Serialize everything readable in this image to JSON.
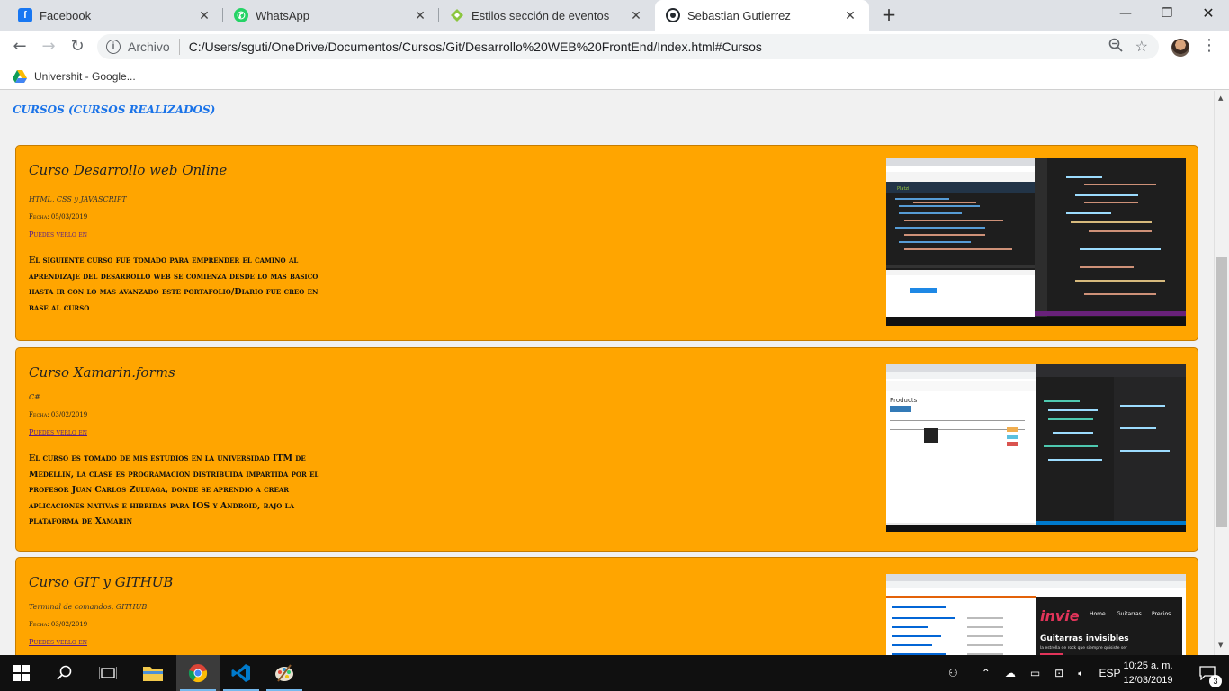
{
  "browser": {
    "tabs": [
      {
        "title": "Facebook",
        "icon": "facebook-icon",
        "color": "#1877f2"
      },
      {
        "title": "WhatsApp",
        "icon": "whatsapp-icon",
        "color": "#25d366"
      },
      {
        "title": "Estilos sección de eventos",
        "icon": "codepen-icon",
        "color": "#8cc63f"
      },
      {
        "title": "Sebastian Gutierrez",
        "icon": "github-icon",
        "color": "#24292e",
        "active": true
      }
    ],
    "omnibox": {
      "label": "Archivo",
      "url": "C:/Users/sguti/OneDrive/Documentos/Cursos/Git/Desarrollo%20WEB%20FrontEnd/Index.html#Cursos"
    },
    "bookmarks": [
      {
        "label": "Univershit - Google..."
      }
    ]
  },
  "page": {
    "section_title": "CURSOS (CURSOS REALIZADOS)",
    "courses": [
      {
        "title": "Curso Desarrollo web Online",
        "subtitle": "HTML, CSS y JAVASCRIPT",
        "date": "Fecha: 05/03/2019",
        "link": "Puedes verlo en",
        "description": "El siguiente curso fue tomado para emprender el camino al aprendizaje del desarrollo web se comienza desde lo mas basico hasta ir con lo mas avanzado este portafolio/Diario fue creo en base al curso"
      },
      {
        "title": "Curso Xamarin.forms",
        "subtitle": "C#",
        "date": "Fecha: 03/02/2019",
        "link": "Puedes verlo en",
        "description": "El curso es tomado de mis estudios en la universidad ITM de Medellin, la clase es programacion distribuida impartida por el profesor Juan Carlos Zuluaga, donde se aprendio a crear aplicaciones nativas e hibridas para IOS y Android, bajo la plataforma de Xamarin"
      },
      {
        "title": "Curso GIT y GITHUB",
        "subtitle": "Terminal de comandos, GITHUB",
        "date": "Fecha: 03/02/2019",
        "link": "Puedes verlo en",
        "description": ""
      }
    ],
    "shot_texts": {
      "platzi": "Platzi",
      "products": "Products",
      "invie_logo": "invie",
      "invie_nav": [
        "Home",
        "Guitarras",
        "Precios"
      ],
      "invie_headline": "Guitarras invisibles",
      "invie_tag": "la estrella de rock que siempre quisiste ser"
    }
  },
  "taskbar": {
    "lang": "ESP",
    "time": "10:25 a. m.",
    "date": "12/03/2019",
    "notifications": "3"
  }
}
